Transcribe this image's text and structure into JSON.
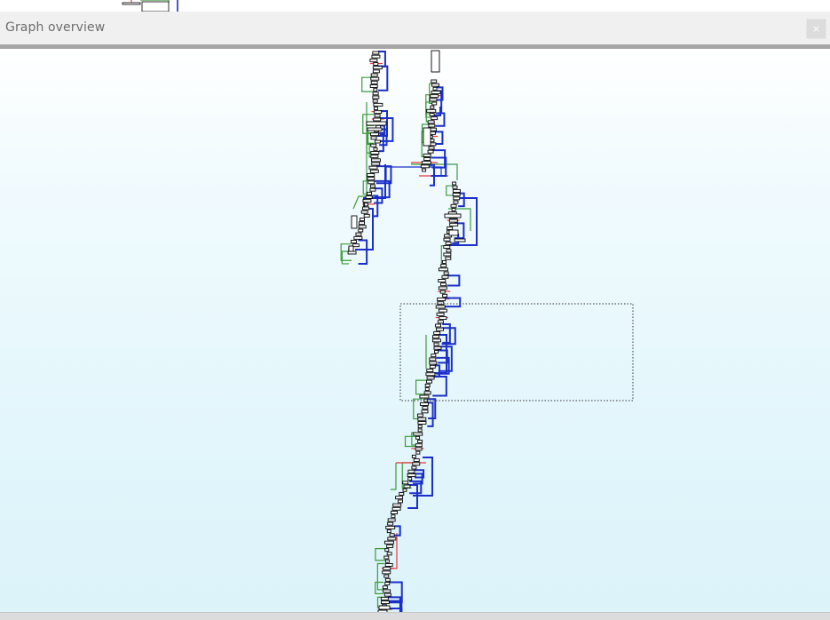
{
  "window": {
    "title": "Graph overview",
    "close_label": "×"
  },
  "icons": {
    "close": "close-icon"
  },
  "colors": {
    "true_branch": "#3c9a3c",
    "false_branch": "#e33b3b",
    "jump": "#1a2fc9",
    "node_border": "#000000",
    "canvas_top": "#ffffff",
    "canvas_bottom": "#dcf3fa"
  }
}
